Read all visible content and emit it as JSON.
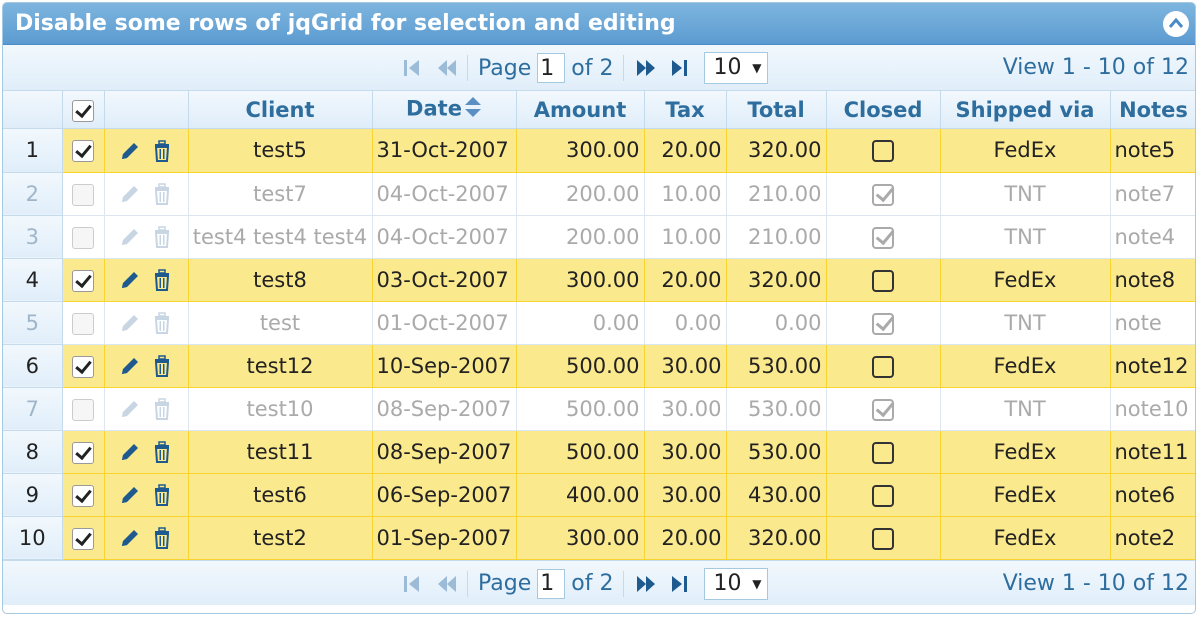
{
  "caption": {
    "title": "Disable some rows of jqGrid for selection and editing"
  },
  "pager": {
    "page_label": "Page",
    "page_value": "1",
    "of_label": "of 2",
    "rows_per_page": "10",
    "records": "View 1 - 10 of 12"
  },
  "columns": {
    "client": "Client",
    "date": "Date",
    "amount": "Amount",
    "tax": "Tax",
    "total": "Total",
    "closed": "Closed",
    "shipped": "Shipped via",
    "notes": "Notes"
  },
  "rows": [
    {
      "rn": "1",
      "selected": true,
      "client": "test5",
      "date": "31-Oct-2007",
      "amount": "300.00",
      "tax": "20.00",
      "total": "320.00",
      "closed": false,
      "shipped": "FedEx",
      "notes": "note5"
    },
    {
      "rn": "2",
      "selected": false,
      "client": "test7",
      "date": "04-Oct-2007",
      "amount": "200.00",
      "tax": "10.00",
      "total": "210.00",
      "closed": true,
      "shipped": "TNT",
      "notes": "note7"
    },
    {
      "rn": "3",
      "selected": false,
      "client": "test4 test4 test4",
      "date": "04-Oct-2007",
      "amount": "200.00",
      "tax": "10.00",
      "total": "210.00",
      "closed": true,
      "shipped": "TNT",
      "notes": "note4"
    },
    {
      "rn": "4",
      "selected": true,
      "client": "test8",
      "date": "03-Oct-2007",
      "amount": "300.00",
      "tax": "20.00",
      "total": "320.00",
      "closed": false,
      "shipped": "FedEx",
      "notes": "note8"
    },
    {
      "rn": "5",
      "selected": false,
      "client": "test",
      "date": "01-Oct-2007",
      "amount": "0.00",
      "tax": "0.00",
      "total": "0.00",
      "closed": true,
      "shipped": "TNT",
      "notes": "note"
    },
    {
      "rn": "6",
      "selected": true,
      "client": "test12",
      "date": "10-Sep-2007",
      "amount": "500.00",
      "tax": "30.00",
      "total": "530.00",
      "closed": false,
      "shipped": "FedEx",
      "notes": "note12"
    },
    {
      "rn": "7",
      "selected": false,
      "client": "test10",
      "date": "08-Sep-2007",
      "amount": "500.00",
      "tax": "30.00",
      "total": "530.00",
      "closed": true,
      "shipped": "TNT",
      "notes": "note10"
    },
    {
      "rn": "8",
      "selected": true,
      "client": "test11",
      "date": "08-Sep-2007",
      "amount": "500.00",
      "tax": "30.00",
      "total": "530.00",
      "closed": false,
      "shipped": "FedEx",
      "notes": "note11"
    },
    {
      "rn": "9",
      "selected": true,
      "client": "test6",
      "date": "06-Sep-2007",
      "amount": "400.00",
      "tax": "30.00",
      "total": "430.00",
      "closed": false,
      "shipped": "FedEx",
      "notes": "note6"
    },
    {
      "rn": "10",
      "selected": true,
      "client": "test2",
      "date": "01-Sep-2007",
      "amount": "300.00",
      "tax": "20.00",
      "total": "320.00",
      "closed": false,
      "shipped": "FedEx",
      "notes": "note2"
    }
  ],
  "colors": {
    "selected_row": "#fbe98e",
    "header_text": "#2e6e9e",
    "caption_bg": "#5c9bd1"
  }
}
